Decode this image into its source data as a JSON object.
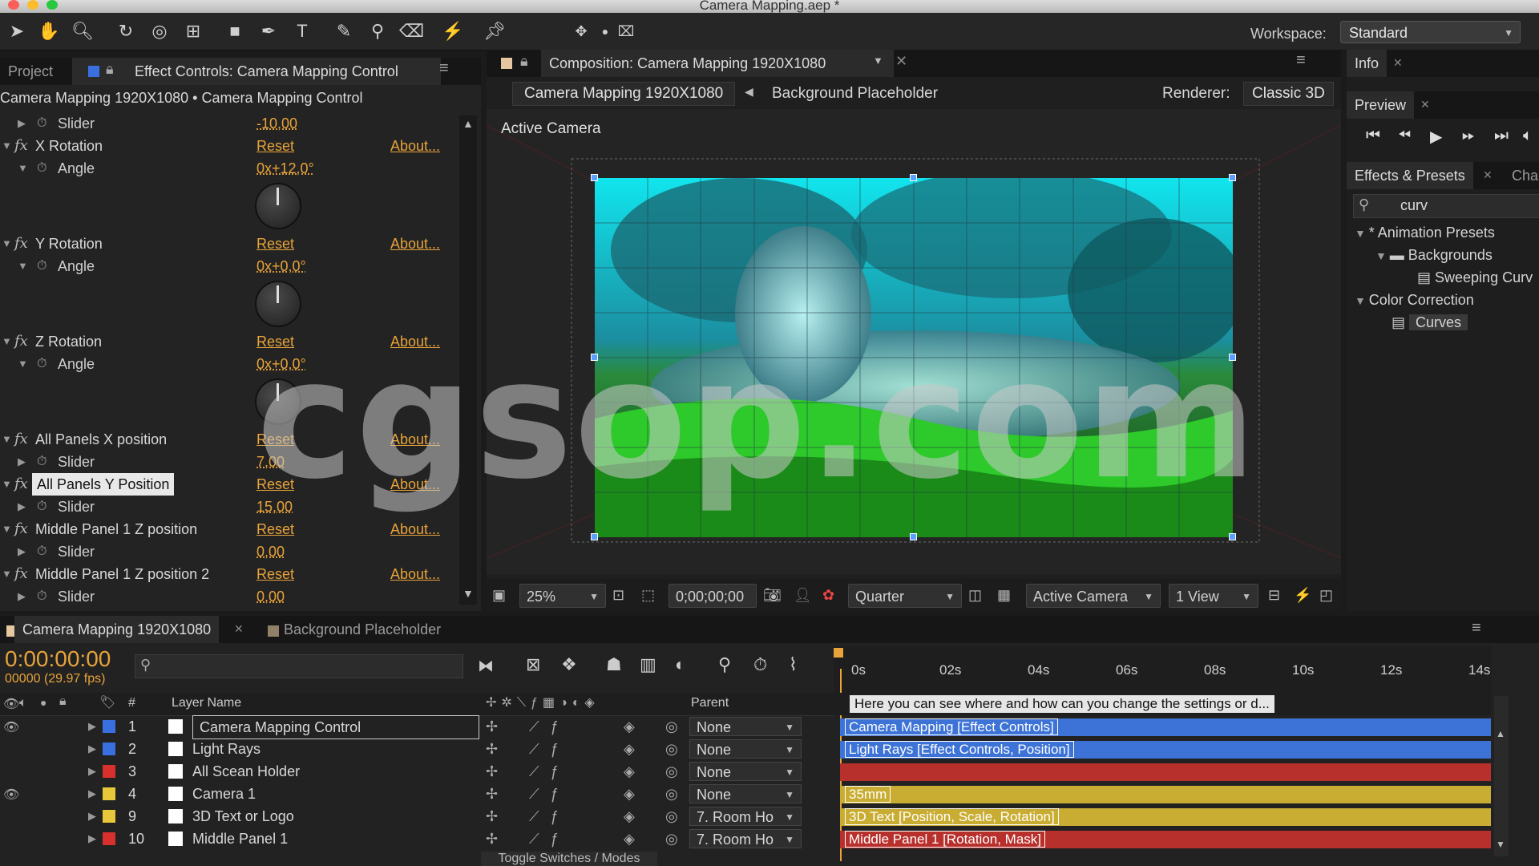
{
  "window": {
    "title": "Camera Mapping.aep *"
  },
  "toolbar": {
    "workspace_label": "Workspace:",
    "workspace_value": "Standard",
    "tools": [
      "selection-tool-icon",
      "hand-tool-icon",
      "zoom-tool-icon",
      "rotate-tool-icon",
      "orbit-camera-icon",
      "track-camera-icon",
      "rectangle-tool-icon",
      "pen-tool-icon",
      "type-tool-icon",
      "brush-tool-icon",
      "clone-stamp-icon",
      "eraser-icon",
      "roto-brush-icon",
      "puppet-pin-icon"
    ]
  },
  "left_panel": {
    "tabs": {
      "project": "Project",
      "effect_controls": "Effect Controls: Camera Mapping Control"
    },
    "breadcrumb": "Camera Mapping 1920X1080 • Camera Mapping Control",
    "reset": "Reset",
    "about": "About...",
    "rows": {
      "slider_top": {
        "label": "Slider",
        "value": "-10,00"
      },
      "x_rotation": {
        "name": "X Rotation",
        "sub": "Angle",
        "value": "0x+12,0°"
      },
      "y_rotation": {
        "name": "Y Rotation",
        "sub": "Angle",
        "value": "0x+0,0°"
      },
      "z_rotation": {
        "name": "Z Rotation",
        "sub": "Angle",
        "value": "0x+0,0°"
      },
      "all_x": {
        "name": "All Panels X position",
        "sub": "Slider",
        "value": "7,00"
      },
      "all_y": {
        "name": "All Panels Y Position",
        "sub": "Slider",
        "value": "15,00"
      },
      "mid1": {
        "name": "Middle Panel 1 Z position",
        "sub": "Slider",
        "value": "0,00"
      },
      "mid2": {
        "name": "Middle Panel 1 Z position 2",
        "sub": "Slider",
        "value": "0,00"
      }
    }
  },
  "composition": {
    "tab": "Composition: Camera Mapping 1920X1080",
    "crumb_active": "Camera Mapping 1920X1080",
    "crumb_next": "Background Placeholder",
    "renderer_label": "Renderer:",
    "renderer_value": "Classic 3D",
    "view_label": "Active Camera",
    "watermark": "cgsop.com",
    "zoom": "25%",
    "timecode": "0;00;00;00",
    "resolution": "Quarter",
    "camera": "Active Camera",
    "views": "1 View"
  },
  "right_panel": {
    "info_tab": "Info",
    "preview_tab": "Preview",
    "effects_tab": "Effects & Presets",
    "char_tab": "Cha",
    "search_value": "curv",
    "tree": {
      "animation_presets": "* Animation Presets",
      "backgrounds": "Backgrounds",
      "sweeping": "Sweeping Curv",
      "color_correction": "Color Correction",
      "curves": "Curves"
    }
  },
  "timeline": {
    "tabs": {
      "main": "Camera Mapping 1920X1080",
      "bg": "Background Placeholder"
    },
    "timecode": "0:00:00:00",
    "frames": "00000 (29.97 fps)",
    "headers": {
      "num": "#",
      "layer_name": "Layer Name",
      "parent": "Parent"
    },
    "ruler": [
      "0s",
      "02s",
      "04s",
      "06s",
      "08s",
      "10s",
      "12s",
      "14s"
    ],
    "comment": "Here you can see where and how can you change the settings or d...",
    "toggle": "Toggle Switches / Modes",
    "layers": [
      {
        "num": "1",
        "name": "Camera Mapping Control",
        "parent": "None",
        "bar": "Camera Mapping [Effect Controls]",
        "color": "#3a6fe0",
        "bar_color": "#3d73d6"
      },
      {
        "num": "2",
        "name": "Light Rays",
        "parent": "None",
        "bar": "Light Rays [Effect Controls, Position]",
        "color": "#3a6fe0",
        "bar_color": "#3d73d6"
      },
      {
        "num": "3",
        "name": "All Scean Holder",
        "parent": "None",
        "bar": "",
        "color": "#d8302d",
        "bar_color": "#b8302c"
      },
      {
        "num": "4",
        "name": "Camera 1",
        "parent": "None",
        "bar": "35mm",
        "color": "#e8c83a",
        "bar_color": "#c9ad32"
      },
      {
        "num": "9",
        "name": "3D Text or Logo",
        "parent": "7. Room Ho",
        "bar": "3D Text [Position, Scale, Rotation]",
        "color": "#e8c83a",
        "bar_color": "#c9ad32"
      },
      {
        "num": "10",
        "name": "Middle Panel 1",
        "parent": "7. Room Ho",
        "bar": "Middle Panel 1 [Rotation, Mask]",
        "color": "#d8302d",
        "bar_color": "#b8302c"
      }
    ]
  }
}
